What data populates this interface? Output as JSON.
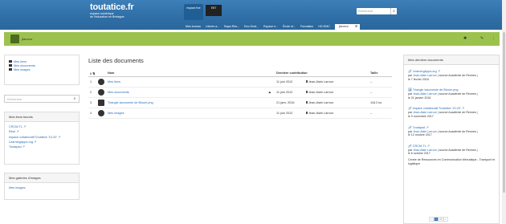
{
  "header": {
    "brand": "toutatice.fr",
    "tagline1": "espace numérique",
    "tagline2": "de l'éducation en Bretagne",
    "badge1": "espace\nfixe",
    "badge2": "ENT",
    "search_placeholder": "Rechercher",
    "nav": [
      "Mes bureau",
      "Liberer a...",
      "Bape-Rés...",
      "Eco-Gest...",
      "Espace e...",
      "École nt...",
      "Formation",
      "HG-EMC"
    ],
    "active_tab": "jfarceur",
    "close_label": "✕"
  },
  "userbar": {
    "username": "jfarceur"
  },
  "left": {
    "menu": [
      "Mes liens",
      "Mes documents",
      "Mes images"
    ],
    "search_placeholder": "Rechercher",
    "favorites": {
      "title": "Mes liens favoris",
      "items": [
        "CRCM-TL ↗",
        "Elisé ↗",
        "espace collaboratif Toutatice '10-20' ↗",
        "LearningApps.org ↗",
        "Toutapad ↗"
      ]
    },
    "gallery": {
      "title": "Mes galeries d'images",
      "items": [
        "Mes images"
      ]
    }
  },
  "main": {
    "title": "Liste des documents",
    "headers": {
      "num": "# ⇅",
      "name": "Nom",
      "date": "Dernière contribution",
      "size": "Taille"
    },
    "rows": [
      {
        "num": "1",
        "name": "Mes liens",
        "date": "11 juin 2012",
        "author": "Jean-Alain Larrour",
        "size": "--",
        "flag": ""
      },
      {
        "num": "2",
        "name": "Mes documents",
        "date": "11 juin 2012",
        "author": "Jean-Alain Larrour",
        "size": "--",
        "flag": "⚑"
      },
      {
        "num": "3",
        "name": "Triangle taxonomie de Bloom.png",
        "date": "21 janv. 2016",
        "author": "Jean-Alain Larrour",
        "size": "116.2 ko",
        "flag": ""
      },
      {
        "num": "4",
        "name": "Mes images",
        "date": "11 juin 2012",
        "author": "Jean-Alain Larrour",
        "size": "--",
        "flag": ""
      }
    ]
  },
  "recent": {
    "title": "Mes derniers documents",
    "items": [
      {
        "title": "🔗 LearningApps.org ↗",
        "by": "par",
        "author": "Jean-Alain Larrour",
        "rest": "| source Académie de Rennes |",
        "date": "le 7 février 2018"
      },
      {
        "title": "🖼 Triangle taxonomie de Bloom.png",
        "by": "par",
        "author": "Jean-Alain Larrour",
        "rest": "| source Académie de Rennes |",
        "date": "le 21 janvier 2016"
      },
      {
        "title": "🔗 espace collaboratif Toutatice '10-20' ↗",
        "by": "par",
        "author": "Jean-Alain Larrour",
        "rest": "| source Académie de Rennes |",
        "date": "le 9 novembre 2017"
      },
      {
        "title": "🔗 Toutapad ↗",
        "by": "par",
        "author": "Jean-Alain Larrour",
        "rest": "| source Académie de Rennes |",
        "date": "le 12 octobre 2017"
      },
      {
        "title": "🔗 CRCM-TL ↗",
        "by": "par",
        "author": "Jean-Alain Larrour",
        "rest": "| source Académie de Rennes |",
        "date": "le 6 octobre 2017",
        "extra": "Centre de Ressources en Communication Mercatique - Transport et logistique"
      }
    ],
    "pager": [
      "‹",
      "1",
      "2",
      "›"
    ]
  }
}
